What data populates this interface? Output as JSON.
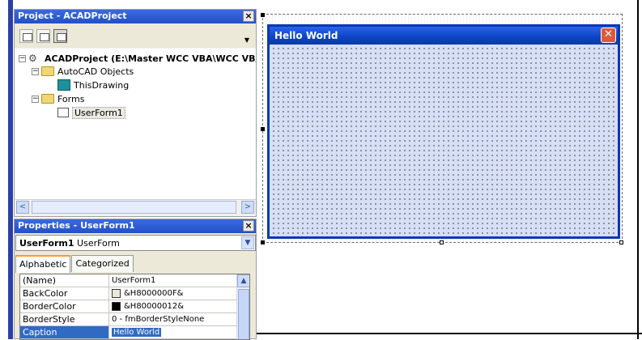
{
  "project_panel": {
    "title": "Project - ACADProject",
    "close_glyph": "×",
    "tree": {
      "root": "ACADProject (E:\\Master WCC VBA\\WCC VB/",
      "autocad_objects": "AutoCAD Objects",
      "this_drawing": "ThisDrawing",
      "forms": "Forms",
      "userform1": "UserForm1"
    },
    "scroll_left": "<",
    "scroll_right": ">"
  },
  "properties_panel": {
    "title": "Properties - UserForm1",
    "close_glyph": "×",
    "object_name": "UserForm1",
    "object_type": "UserForm",
    "tabs": [
      "Alphabetic",
      "Categorized"
    ],
    "active_tab": "Alphabetic",
    "rows": [
      {
        "name": "(Name)",
        "value": "UserForm1"
      },
      {
        "name": "BackColor",
        "value": "&H8000000F&",
        "swatch": "#ece9d8"
      },
      {
        "name": "BorderColor",
        "value": "&H80000012&",
        "swatch": "#000000"
      },
      {
        "name": "BorderStyle",
        "value": "0 - fmBorderStyleNone"
      },
      {
        "name": "Caption",
        "value": "Hello World",
        "selected": true
      }
    ]
  },
  "form": {
    "title": "Hello World",
    "close_glyph": "✕"
  }
}
